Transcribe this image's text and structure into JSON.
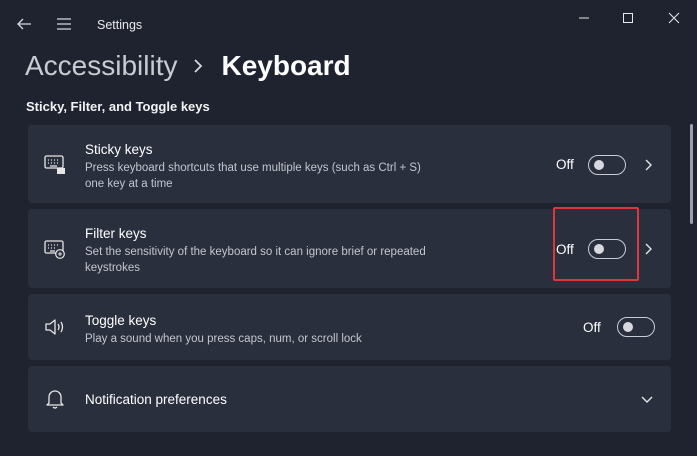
{
  "window": {
    "title": "Settings"
  },
  "breadcrumb": {
    "parent": "Accessibility",
    "current": "Keyboard"
  },
  "section": {
    "title": "Sticky, Filter, and Toggle keys"
  },
  "items": [
    {
      "title": "Sticky keys",
      "desc1": "Press keyboard shortcuts that use multiple keys (such as Ctrl + S)",
      "desc2": "one key at a time",
      "state": "Off",
      "toggle_on": false,
      "icon": "keyboard-sticky-icon"
    },
    {
      "title": "Filter keys",
      "desc1": "Set the sensitivity of the keyboard so it can ignore brief or repeated",
      "desc2": "keystrokes",
      "state": "Off",
      "toggle_on": false,
      "icon": "keyboard-filter-icon"
    },
    {
      "title": "Toggle keys",
      "desc1": "Play a sound when you press caps, num, or scroll lock",
      "state": "Off",
      "toggle_on": false,
      "icon": "speaker-icon"
    }
  ],
  "notifications": {
    "label": "Notification preferences",
    "icon": "bell-icon"
  },
  "colors": {
    "background": "#1f2330",
    "card": "#2a2f3d",
    "highlight": "#e0353b"
  }
}
